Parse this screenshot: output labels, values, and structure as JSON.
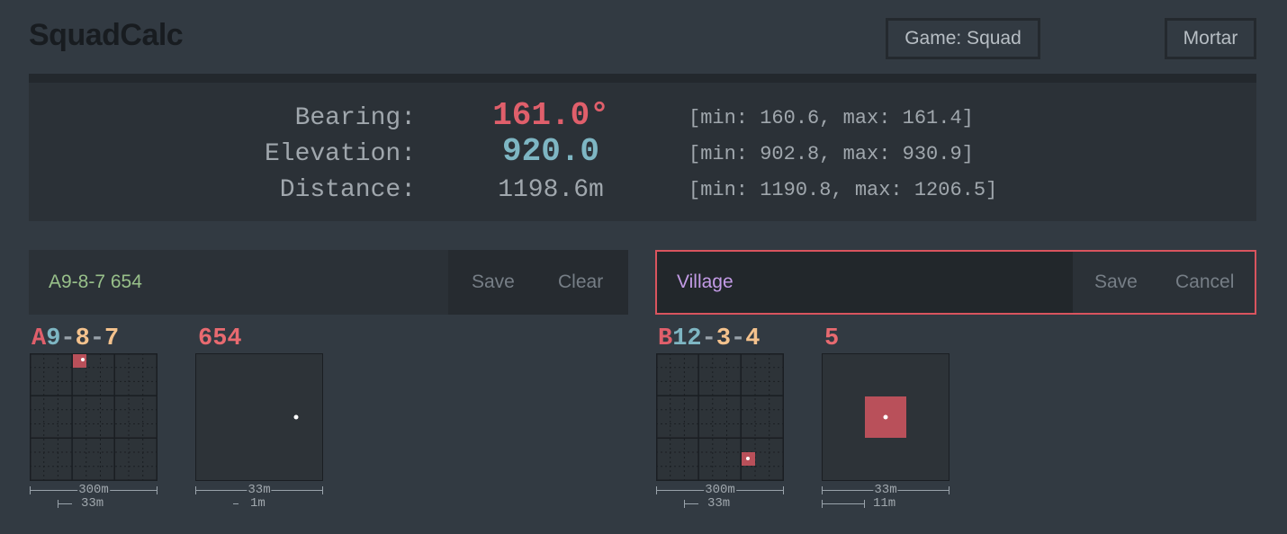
{
  "app": {
    "title": "SquadCalc"
  },
  "header": {
    "game_button": "Game: Squad",
    "weapon_button": "Mortar"
  },
  "results": {
    "bearing": {
      "label": "Bearing:",
      "value": "161.0°",
      "range": "[min: 160.6, max: 161.4]"
    },
    "elevation": {
      "label": "Elevation:",
      "value": "920.0",
      "range": "[min: 902.8, max: 930.9]"
    },
    "distance": {
      "label": "Distance:",
      "value": "1198.6m",
      "range": "[min: 1190.8, max: 1206.5]"
    }
  },
  "mortar": {
    "input_value": "A9-8-7 654",
    "save_label": "Save",
    "clear_label": "Clear",
    "coord": {
      "letter": "A",
      "number": "9",
      "kp1": "8",
      "kp2": "7",
      "sub": "654"
    },
    "scale1": {
      "top": "300m",
      "bottom": "33m"
    },
    "scale2": {
      "top": "33m",
      "bottom": "1m"
    }
  },
  "target": {
    "input_value": "Village",
    "save_label": "Save",
    "cancel_label": "Cancel",
    "coord": {
      "letter": "B",
      "number": "12",
      "kp1": "3",
      "kp2": "4",
      "sub": "5"
    },
    "scale1": {
      "top": "300m",
      "bottom": "33m"
    },
    "scale2": {
      "top": "33m",
      "bottom": "11m"
    }
  },
  "colors": {
    "letter": "#e05f6b",
    "number": "#7eb6c3",
    "keypad": "#f4c28d",
    "mortar_input": "#98c08a",
    "target_input": "#c39be6",
    "marker": "#b9505a",
    "active_border": "#d9545e"
  }
}
